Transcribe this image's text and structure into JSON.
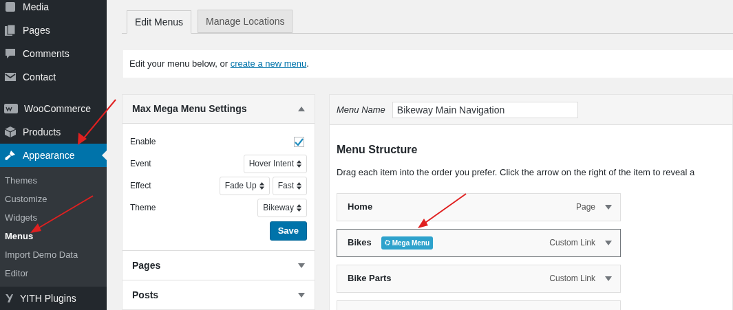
{
  "sidebar": {
    "items": [
      {
        "label": "Media",
        "selected": false
      },
      {
        "label": "Pages",
        "selected": false
      },
      {
        "label": "Comments",
        "selected": false
      },
      {
        "label": "Contact",
        "selected": false
      },
      {
        "label": "WooCommerce",
        "selected": false
      },
      {
        "label": "Products",
        "selected": false
      },
      {
        "label": "Appearance",
        "selected": true,
        "children": [
          {
            "label": "Themes",
            "selected": false
          },
          {
            "label": "Customize",
            "selected": false
          },
          {
            "label": "Widgets",
            "selected": false
          },
          {
            "label": "Menus",
            "selected": true
          },
          {
            "label": "Import Demo Data",
            "selected": false
          },
          {
            "label": "Editor",
            "selected": false
          }
        ]
      },
      {
        "label": "YITH Plugins",
        "selected": false
      }
    ]
  },
  "tabs": [
    {
      "label": "Edit Menus",
      "selected": true
    },
    {
      "label": "Manage Locations",
      "selected": false
    }
  ],
  "notice": {
    "text": "Edit your menu below, or ",
    "link": "create a new menu",
    "end": "."
  },
  "settings_panel": {
    "title": "Max Mega Menu Settings",
    "expanded": true,
    "rows": [
      {
        "label": "Enable",
        "kind": "checkbox",
        "checked": true
      },
      {
        "label": "Event",
        "kind": "select",
        "values": [
          "Hover Intent"
        ]
      },
      {
        "label": "Effect",
        "kind": "select",
        "values": [
          "Fade Up",
          "Fast"
        ]
      },
      {
        "label": "Theme",
        "kind": "select",
        "values": [
          "Bikeway"
        ]
      }
    ],
    "button": "Save"
  },
  "sections": [
    {
      "title": "Pages",
      "expanded": false
    },
    {
      "title": "Posts",
      "expanded": false
    }
  ],
  "menu_name": {
    "label": "Menu Name",
    "value": "Bikeway Main Navigation"
  },
  "menu_structure": {
    "title": "Menu Structure",
    "hint": "Drag each item into the order you prefer. Click the arrow on the right of the item to reveal a",
    "items": [
      {
        "title": "Home",
        "type": "Page",
        "selected": false
      },
      {
        "title": "Bikes",
        "badge": "Mega Menu",
        "type": "Custom Link",
        "selected": true
      },
      {
        "title": "Bike Parts",
        "type": "Custom Link",
        "selected": false
      },
      {
        "selected": false
      }
    ]
  }
}
